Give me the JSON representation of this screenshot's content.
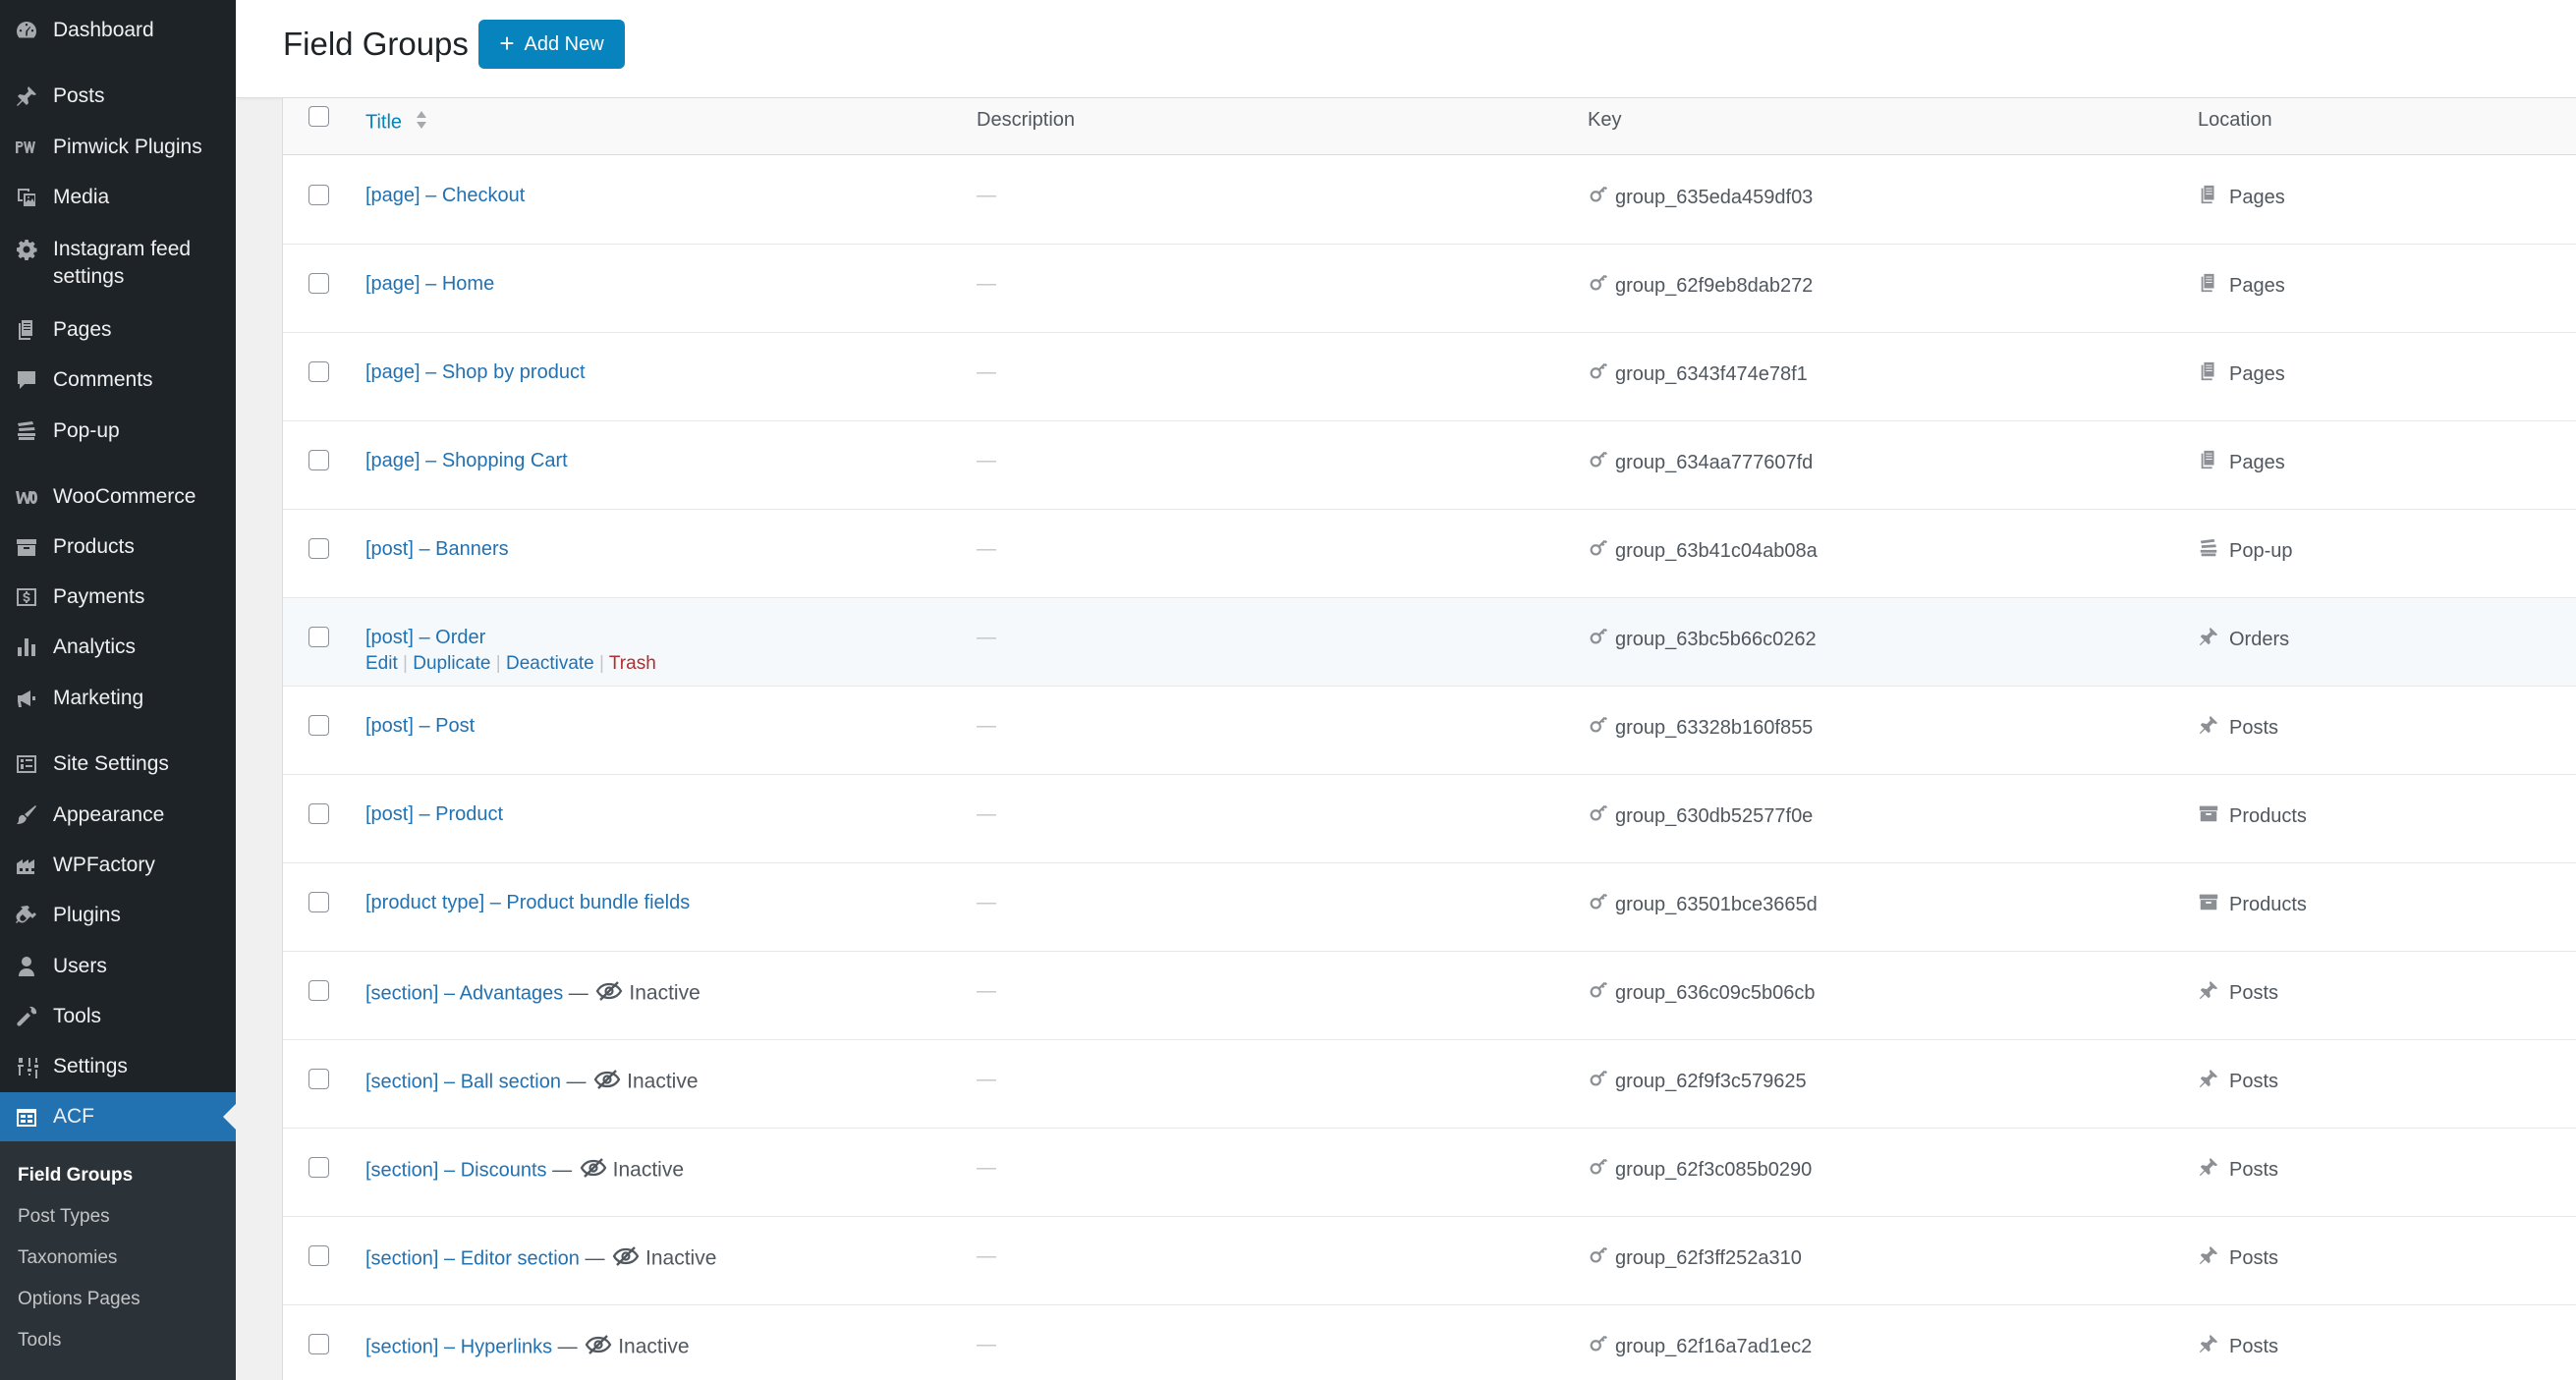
{
  "sidebar": {
    "items": [
      {
        "label": "Dashboard",
        "icon": "dashboard-icon"
      },
      {
        "label": "Posts",
        "icon": "pin-icon"
      },
      {
        "label": "Pimwick Plugins",
        "icon": "pw-icon"
      },
      {
        "label": "Media",
        "icon": "media-icon"
      },
      {
        "label": "Instagram feed settings",
        "icon": "gear-icon"
      },
      {
        "label": "Pages",
        "icon": "pages-icon"
      },
      {
        "label": "Comments",
        "icon": "comment-icon"
      },
      {
        "label": "Pop-up",
        "icon": "popup-icon"
      },
      {
        "label": "WooCommerce",
        "icon": "woo-icon"
      },
      {
        "label": "Products",
        "icon": "archive-icon"
      },
      {
        "label": "Payments",
        "icon": "dollar-icon"
      },
      {
        "label": "Analytics",
        "icon": "bar-chart-icon"
      },
      {
        "label": "Marketing",
        "icon": "megaphone-icon"
      },
      {
        "label": "Site Settings",
        "icon": "site-settings-icon"
      },
      {
        "label": "Appearance",
        "icon": "brush-icon"
      },
      {
        "label": "WPFactory",
        "icon": "factory-icon"
      },
      {
        "label": "Plugins",
        "icon": "plugin-icon"
      },
      {
        "label": "Users",
        "icon": "user-icon"
      },
      {
        "label": "Tools",
        "icon": "wrench-icon"
      },
      {
        "label": "Settings",
        "icon": "settings-icon"
      },
      {
        "label": "ACF",
        "icon": "acf-icon"
      }
    ],
    "submenu": [
      "Field Groups",
      "Post Types",
      "Taxonomies",
      "Options Pages",
      "Tools"
    ]
  },
  "header": {
    "title": "Field Groups",
    "add_new": "Add New"
  },
  "table": {
    "columns": {
      "title": "Title",
      "description": "Description",
      "key": "Key",
      "location": "Location"
    },
    "row_actions": {
      "edit": "Edit",
      "duplicate": "Duplicate",
      "deactivate": "Deactivate",
      "trash": "Trash"
    },
    "inactive_label": "Inactive",
    "dash": "—",
    "rows": [
      {
        "title": "[page] – Checkout",
        "key": "group_635eda459df03",
        "location": "Pages",
        "loc_icon": "pages-icon",
        "inactive": false
      },
      {
        "title": "[page] – Home",
        "key": "group_62f9eb8dab272",
        "location": "Pages",
        "loc_icon": "pages-icon",
        "inactive": false
      },
      {
        "title": "[page] – Shop by product",
        "key": "group_6343f474e78f1",
        "location": "Pages",
        "loc_icon": "pages-icon",
        "inactive": false
      },
      {
        "title": "[page] – Shopping Cart",
        "key": "group_634aa777607fd",
        "location": "Pages",
        "loc_icon": "pages-icon",
        "inactive": false
      },
      {
        "title": "[post] – Banners",
        "key": "group_63b41c04ab08a",
        "location": "Pop-up",
        "loc_icon": "popup-icon",
        "inactive": false
      },
      {
        "title": "[post] – Order",
        "key": "group_63bc5b66c0262",
        "location": "Orders",
        "loc_icon": "pin-icon",
        "inactive": false,
        "hover": true
      },
      {
        "title": "[post] – Post",
        "key": "group_63328b160f855",
        "location": "Posts",
        "loc_icon": "pin-icon",
        "inactive": false
      },
      {
        "title": "[post] – Product",
        "key": "group_630db52577f0e",
        "location": "Products",
        "loc_icon": "archive-icon",
        "inactive": false
      },
      {
        "title": "[product type] – Product bundle fields",
        "key": "group_63501bce3665d",
        "location": "Products",
        "loc_icon": "archive-icon",
        "inactive": false
      },
      {
        "title": "[section] – Advantages",
        "key": "group_636c09c5b06cb",
        "location": "Posts",
        "loc_icon": "pin-icon",
        "inactive": true
      },
      {
        "title": "[section] – Ball section",
        "key": "group_62f9f3c579625",
        "location": "Posts",
        "loc_icon": "pin-icon",
        "inactive": true
      },
      {
        "title": "[section] – Discounts",
        "key": "group_62f3c085b0290",
        "location": "Posts",
        "loc_icon": "pin-icon",
        "inactive": true
      },
      {
        "title": "[section] – Editor section",
        "key": "group_62f3ff252a310",
        "location": "Posts",
        "loc_icon": "pin-icon",
        "inactive": true
      },
      {
        "title": "[section] – Hyperlinks",
        "key": "group_62f16a7ad1ec2",
        "location": "Posts",
        "loc_icon": "pin-icon",
        "inactive": true
      }
    ]
  },
  "colors": {
    "sidebar_bg": "#1d2327",
    "accent": "#2271b1",
    "button": "#0783be",
    "trash": "#b32d2e"
  }
}
